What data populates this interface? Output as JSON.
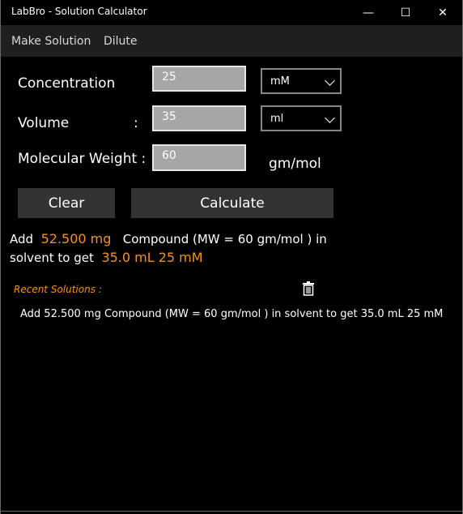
{
  "window": {
    "title": "LabBro - Solution Calculator",
    "controls": {
      "minimize": "—",
      "maximize": "☐",
      "close": "✕"
    }
  },
  "menu": {
    "items": [
      "Make Solution",
      "Dilute"
    ]
  },
  "form": {
    "concentration": {
      "label": "Concentration",
      "value": "25",
      "unit": "mM"
    },
    "volume": {
      "label": "Volume",
      "colon": ":",
      "value": "35",
      "unit": "ml"
    },
    "molecular_weight": {
      "label": "Molecular Weight :",
      "value": "60",
      "unit": "gm/mol"
    }
  },
  "buttons": {
    "clear": "Clear",
    "calculate": "Calculate"
  },
  "result": {
    "prefix": "Add",
    "amount": "52.500 mg",
    "middle": "Compound (MW = 60 gm/mol ) in",
    "line2_prefix": "solvent to get",
    "target": "35.0 mL 25 mM"
  },
  "recent": {
    "title": "Recent Solutions :",
    "items": [
      "Add  52.500 mg   Compound (MW = 60 gm/mol ) in  solvent to get  35.0 mL 25 mM"
    ]
  },
  "colors": {
    "accent": "#f7901e",
    "background": "#000000",
    "input_bg": "#a6a6a6",
    "button_bg": "#333333"
  }
}
